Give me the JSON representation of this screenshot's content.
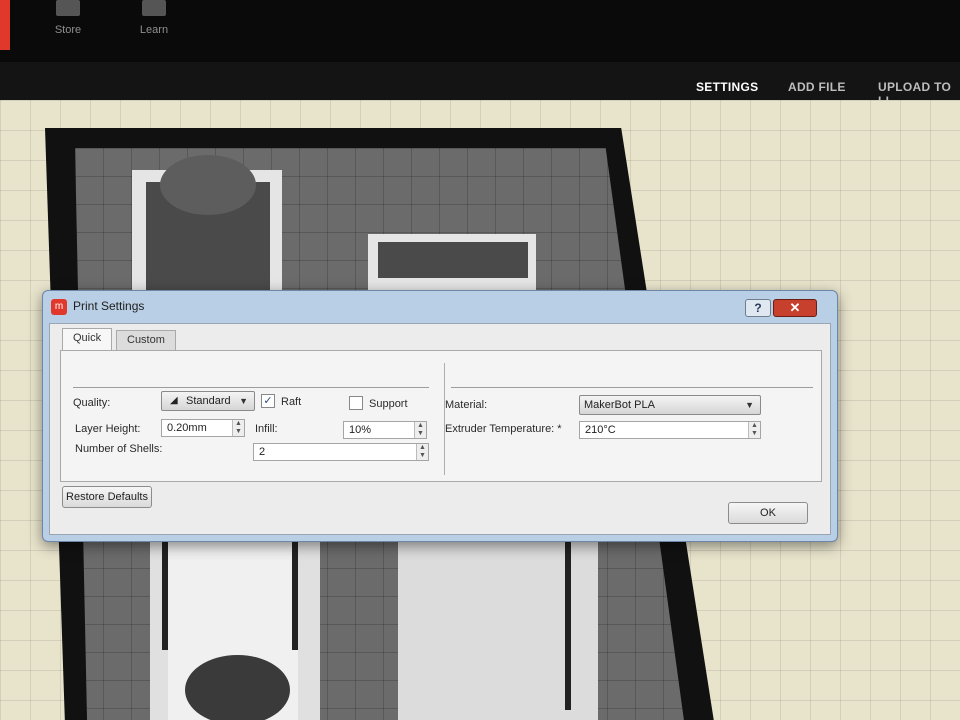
{
  "topnav": {
    "items": [
      {
        "label": "Store",
        "icon": "store-icon"
      },
      {
        "label": "Learn",
        "icon": "learn-icon"
      }
    ]
  },
  "subnav": {
    "settings": "SETTINGS",
    "add_file": "ADD FILE",
    "upload": "UPLOAD TO LI"
  },
  "dialog": {
    "title": "Print Settings",
    "help": "?",
    "close": "✕",
    "tabs": [
      {
        "label": "Quick",
        "active": true
      },
      {
        "label": "Custom",
        "active": false
      }
    ],
    "quality_label": "Quality:",
    "quality_value": "Standard",
    "raft_label": "Raft",
    "raft_checked": true,
    "support_label": "Support",
    "support_checked": false,
    "layer_height_label": "Layer Height:",
    "layer_height_value": "0.20mm",
    "infill_label": "Infill:",
    "infill_value": "10%",
    "shells_label": "Number of Shells:",
    "shells_value": "2",
    "material_label": "Material:",
    "material_value": "MakerBot PLA",
    "extruder_temp_label": "Extruder Temperature: *",
    "extruder_temp_value": "210°C",
    "restore_defaults": "Restore Defaults",
    "ok": "OK"
  },
  "colors": {
    "brand": "#e0392b",
    "dialog_frame": "#b9cfe6",
    "workspace": "#e8e4cc"
  }
}
